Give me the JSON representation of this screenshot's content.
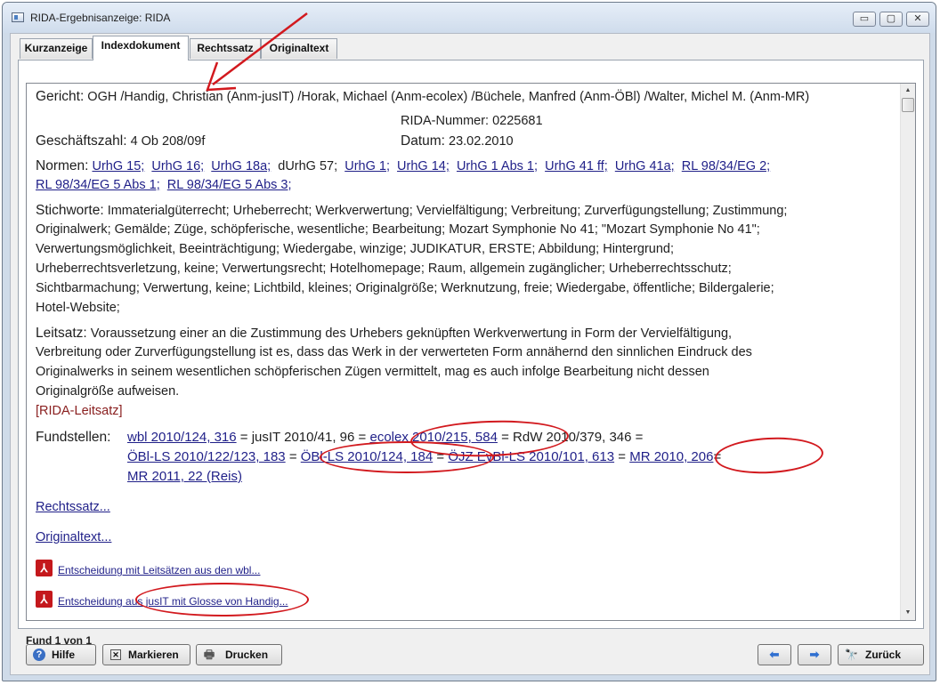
{
  "window": {
    "title": "RIDA-Ergebnisanzeige: RIDA"
  },
  "window_controls": {
    "minimize": "▭",
    "maximize": "▢",
    "close": "✕"
  },
  "tabs": [
    "Kurzanzeige",
    "Indexdokument",
    "Rechtssatz",
    "Originaltext"
  ],
  "document": {
    "gericht_label": "Gericht:",
    "gericht_value": "OGH /Handig, Christian (Anm-jusIT) /Horak, Michael (Anm-ecolex) /Büchele, Manfred (Anm-ÖBl) /Walter, Michel M. (Anm-MR)",
    "rida_nummer": "RIDA-Nummer: 0225681",
    "gz_label": "Geschäftszahl:",
    "gz_value": "4 Ob 208/09f",
    "datum_label": "Datum:",
    "datum_value": "23.02.2010",
    "normen_label": "Normen:",
    "normen_line1": [
      "UrhG 15;",
      "UrhG 16;",
      "UrhG 18a;",
      "dUrhG 57;",
      "UrhG 1;",
      "UrhG 14;",
      "UrhG 1 Abs 1;",
      "UrhG 41 ff;",
      "UrhG 41a;",
      "RL 98/34/EG 2;"
    ],
    "normen_line2": [
      "RL 98/34/EG 5 Abs 1;",
      "RL 98/34/EG 5 Abs 3;"
    ],
    "stichworte_label": "Stichworte:",
    "stichworte_lines": [
      "Immaterialgüterrecht;  Urheberrecht;  Werkverwertung;  Vervielfältigung;  Verbreitung;  Zurverfügungstellung;  Zustimmung;",
      "Originalwerk;  Gemälde;  Züge, schöpferische, wesentliche;  Bearbeitung;  Mozart Symphonie No 41;  \"Mozart Symphonie No 41\";",
      "Verwertungsmöglichkeit, Beeinträchtigung;  Wiedergabe, winzige;  JUDIKATUR, ERSTE;  Abbildung;  Hintergrund;",
      "Urheberrechtsverletzung, keine;  Verwertungsrecht;  Hotelhomepage;  Raum, allgemein zugänglicher;  Urheberrechtsschutz;",
      "Sichtbarmachung;  Verwertung, keine;  Lichtbild, kleines;  Originalgröße;  Werknutzung, freie;  Wiedergabe, öffentliche;  Bildergalerie;",
      "Hotel-Website;"
    ],
    "leitsatz_label": "Leitsatz:",
    "leitsatz_lines": [
      "Voraussetzung einer an die Zustimmung des Urhebers geknüpften Werkverwertung in Form der Vervielfältigung,",
      "Verbreitung oder Zurverfügungstellung ist es, dass das Werk in der verwerteten Form annähernd den sinnlichen Eindruck des",
      "Originalwerks in seinem wesentlichen schöpferischen Zügen vermittelt, mag es auch infolge Bearbeitung nicht dessen",
      "Originalgröße aufweisen."
    ],
    "rida_leitsatz": "[RIDA-Leitsatz]",
    "fundstellen_label": "Fundstellen:",
    "fund": {
      "f1": "wbl 2010/124, 316",
      "e1": "=",
      "f2": "jusIT 2010/41, 96",
      "e2": "=",
      "f3": "ecolex 2010/215, 584",
      "e3": "=",
      "f4": "RdW 2010/379, 346",
      "e4": "=",
      "f5": "ÖBl-LS 2010/122/123, 183",
      "e5": "=",
      "f6": "ÖBl-LS 2010/124, 184",
      "e6": "=",
      "f7": "ÖJZ EvBl-LS 2010/101, 613",
      "e7": "=",
      "f8": "MR 2010, 206",
      "e8": "=",
      "f9": "MR 2011, 22 (Reis)"
    },
    "rechtssatz_link": "Rechtssatz...",
    "originaltext_link": "Originaltext...",
    "pdf_icon_text": "⅄",
    "pdf1": "Entscheidung mit Leitsätzen aus den wbl...",
    "pdf2": "Entscheidung aus jusIT mit Glosse von Handig..."
  },
  "scrollbar": {
    "up": "▲",
    "down": "▼"
  },
  "status": {
    "fund": "Fund 1 von 1"
  },
  "buttons": {
    "hilfe": "Hilfe",
    "hilfe_icon": "?",
    "markieren": "Markieren",
    "markieren_icon": "✕",
    "drucken": "Drucken",
    "drucken_icon": "🖶",
    "back_icon": "⬅",
    "forward_icon": "➡",
    "zurueck": "Zurück",
    "zurueck_icon": "🔭"
  },
  "colors": {
    "annotation": "#d2191e",
    "link": "#1f1f88",
    "pdf": "#c4181c"
  }
}
